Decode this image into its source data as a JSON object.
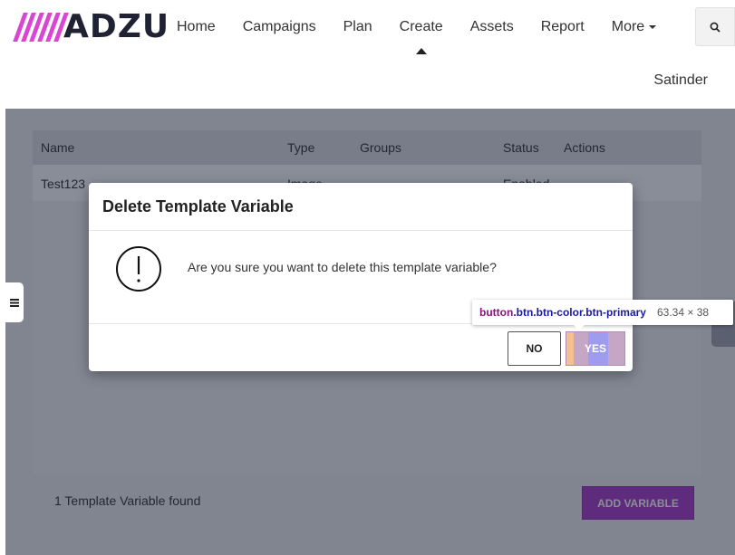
{
  "brand": {
    "logo_text": "ADZU",
    "accent": "#d946d2"
  },
  "nav": {
    "items": [
      "Home",
      "Campaigns",
      "Plan",
      "Create",
      "Assets",
      "Report",
      "More"
    ],
    "active": "Create",
    "search_icon": "search-icon"
  },
  "user": {
    "name": "Satinder"
  },
  "table": {
    "headers": [
      "Name",
      "Type",
      "Groups",
      "Status",
      "Actions"
    ],
    "rows": [
      {
        "name": "Test123",
        "type": "Image",
        "groups": "",
        "status": "Enabled"
      }
    ]
  },
  "footer": {
    "count_text": "1 Template Variable found",
    "add_button": "ADD VARIABLE"
  },
  "modal": {
    "title": "Delete Template Variable",
    "message": "Are you sure you want to delete this template variable?",
    "no_label": "NO",
    "yes_label": "YES",
    "warning_icon": "exclamation-circle-icon"
  },
  "devtools_tooltip": {
    "tag": "button",
    "classes": ".btn.btn-color.btn-primary",
    "size": "63.34 × 38"
  },
  "colors": {
    "primary": "#a93bc9",
    "overlay": "rgba(20,28,50,0.5)"
  }
}
